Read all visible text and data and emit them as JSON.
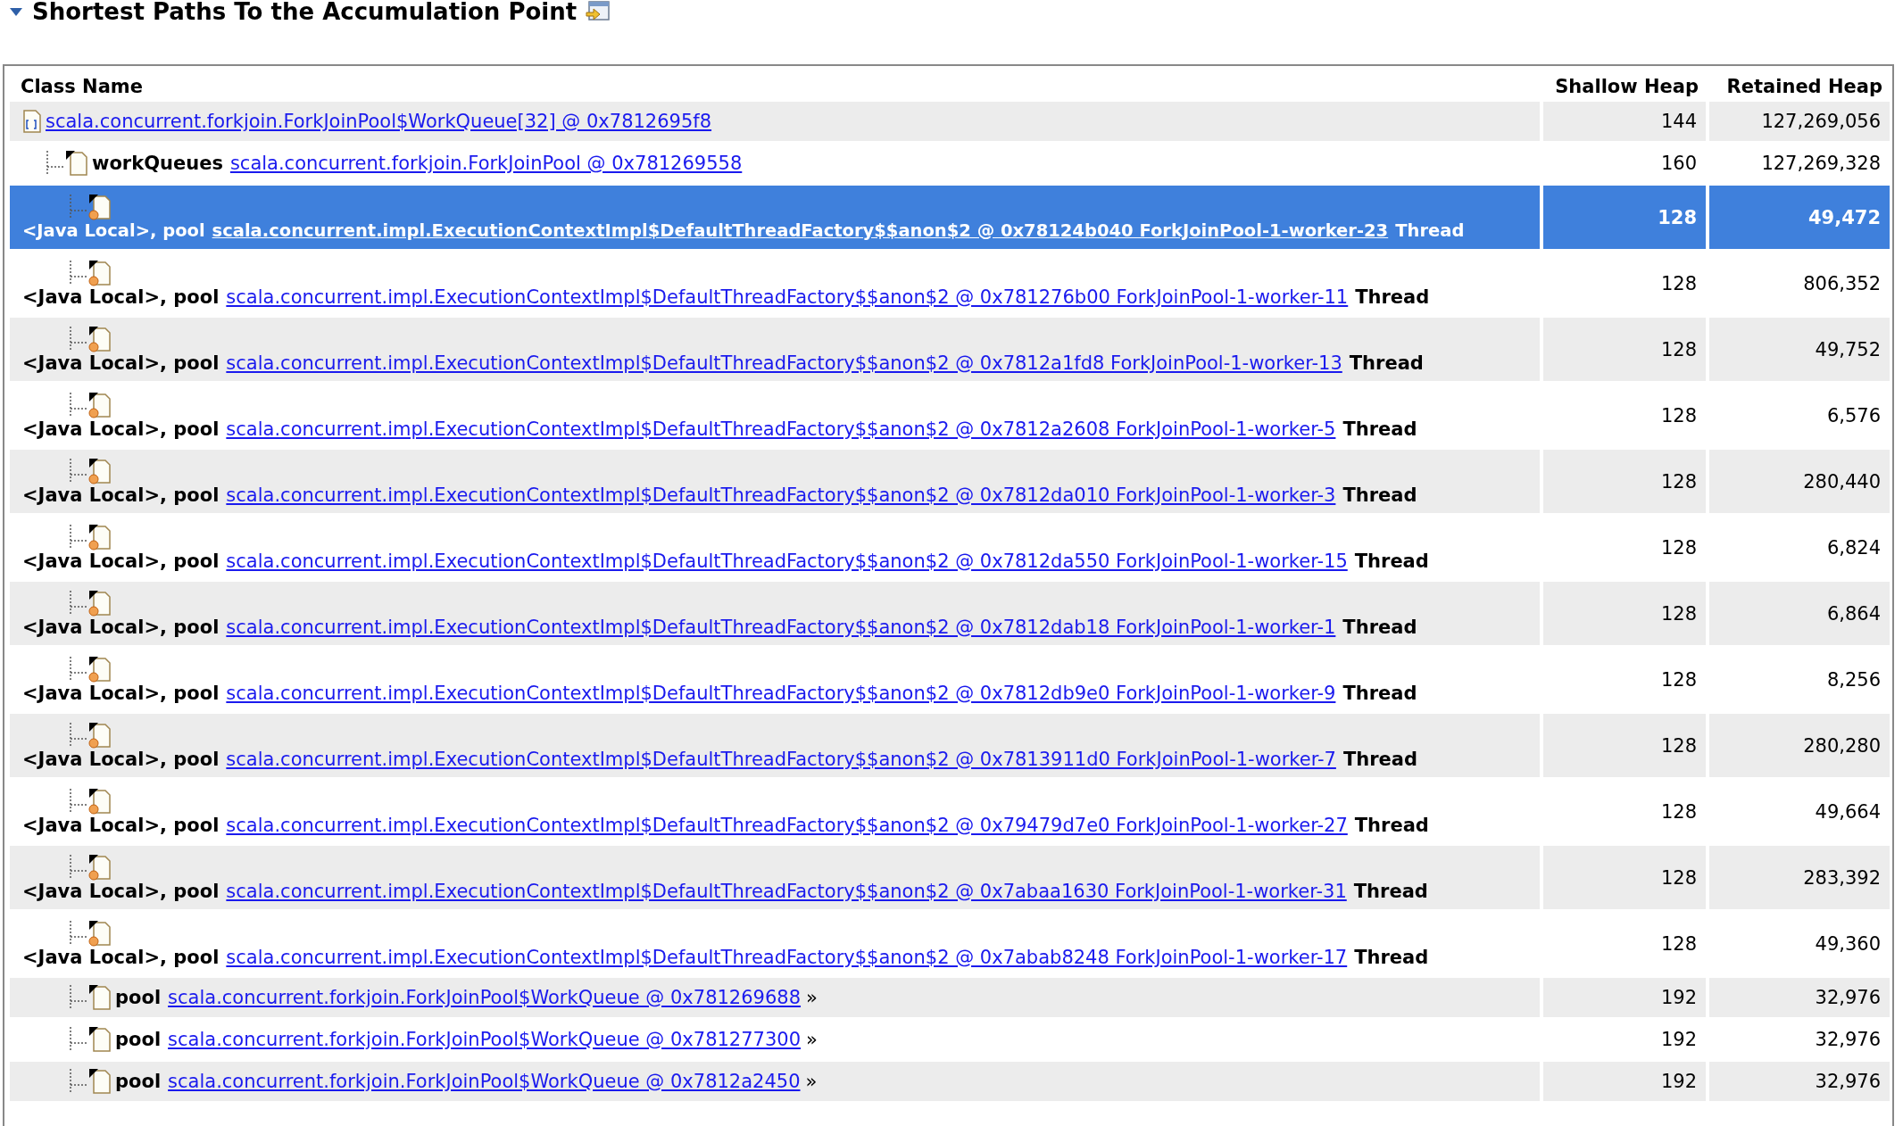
{
  "section": {
    "title": "Shortest Paths To the Accumulation Point",
    "expanded": true
  },
  "table": {
    "columns": [
      "Class Name",
      "Shallow Heap",
      "Retained Heap"
    ],
    "rows": [
      {
        "kind": "array",
        "link": "scala.concurrent.forkjoin.ForkJoinPool$WorkQueue[32] @ 0x7812695f8",
        "shallow": "144",
        "retained": "127,269,056",
        "selected": false,
        "children": [
          {
            "kind": "object",
            "prefix": "workQueues",
            "link": "scala.concurrent.forkjoin.ForkJoinPool @ 0x781269558",
            "shallow": "160",
            "retained": "127,269,328",
            "selected": false,
            "children": [
              {
                "kind": "root",
                "prefix": "<Java Local>, pool",
                "link": "scala.concurrent.impl.ExecutionContextImpl$DefaultThreadFactory$$anon$2 @ 0x78124b040 ForkJoinPool-1-worker-23",
                "suffix": "Thread",
                "shallow": "128",
                "retained": "49,472",
                "selected": true
              },
              {
                "kind": "root",
                "prefix": "<Java Local>, pool",
                "link": "scala.concurrent.impl.ExecutionContextImpl$DefaultThreadFactory$$anon$2 @ 0x781276b00 ForkJoinPool-1-worker-11",
                "suffix": "Thread",
                "shallow": "128",
                "retained": "806,352",
                "selected": false
              },
              {
                "kind": "root",
                "prefix": "<Java Local>, pool",
                "link": "scala.concurrent.impl.ExecutionContextImpl$DefaultThreadFactory$$anon$2 @ 0x7812a1fd8 ForkJoinPool-1-worker-13",
                "suffix": "Thread",
                "shallow": "128",
                "retained": "49,752",
                "selected": false
              },
              {
                "kind": "root",
                "prefix": "<Java Local>, pool",
                "link": "scala.concurrent.impl.ExecutionContextImpl$DefaultThreadFactory$$anon$2 @ 0x7812a2608 ForkJoinPool-1-worker-5",
                "suffix": "Thread",
                "shallow": "128",
                "retained": "6,576",
                "selected": false
              },
              {
                "kind": "root",
                "prefix": "<Java Local>, pool",
                "link": "scala.concurrent.impl.ExecutionContextImpl$DefaultThreadFactory$$anon$2 @ 0x7812da010 ForkJoinPool-1-worker-3",
                "suffix": "Thread",
                "shallow": "128",
                "retained": "280,440",
                "selected": false
              },
              {
                "kind": "root",
                "prefix": "<Java Local>, pool",
                "link": "scala.concurrent.impl.ExecutionContextImpl$DefaultThreadFactory$$anon$2 @ 0x7812da550 ForkJoinPool-1-worker-15",
                "suffix": "Thread",
                "shallow": "128",
                "retained": "6,824",
                "selected": false
              },
              {
                "kind": "root",
                "prefix": "<Java Local>, pool",
                "link": "scala.concurrent.impl.ExecutionContextImpl$DefaultThreadFactory$$anon$2 @ 0x7812dab18 ForkJoinPool-1-worker-1",
                "suffix": "Thread",
                "shallow": "128",
                "retained": "6,864",
                "selected": false
              },
              {
                "kind": "root",
                "prefix": "<Java Local>, pool",
                "link": "scala.concurrent.impl.ExecutionContextImpl$DefaultThreadFactory$$anon$2 @ 0x7812db9e0 ForkJoinPool-1-worker-9",
                "suffix": "Thread",
                "shallow": "128",
                "retained": "8,256",
                "selected": false
              },
              {
                "kind": "root",
                "prefix": "<Java Local>, pool",
                "link": "scala.concurrent.impl.ExecutionContextImpl$DefaultThreadFactory$$anon$2 @ 0x7813911d0 ForkJoinPool-1-worker-7",
                "suffix": "Thread",
                "shallow": "128",
                "retained": "280,280",
                "selected": false
              },
              {
                "kind": "root",
                "prefix": "<Java Local>, pool",
                "link": "scala.concurrent.impl.ExecutionContextImpl$DefaultThreadFactory$$anon$2 @ 0x79479d7e0 ForkJoinPool-1-worker-27",
                "suffix": "Thread",
                "shallow": "128",
                "retained": "49,664",
                "selected": false
              },
              {
                "kind": "root",
                "prefix": "<Java Local>, pool",
                "link": "scala.concurrent.impl.ExecutionContextImpl$DefaultThreadFactory$$anon$2 @ 0x7abaa1630 ForkJoinPool-1-worker-31",
                "suffix": "Thread",
                "shallow": "128",
                "retained": "283,392",
                "selected": false
              },
              {
                "kind": "root",
                "prefix": "<Java Local>, pool",
                "link": "scala.concurrent.impl.ExecutionContextImpl$DefaultThreadFactory$$anon$2 @ 0x7abab8248 ForkJoinPool-1-worker-17",
                "suffix": "Thread",
                "shallow": "128",
                "retained": "49,360",
                "selected": false
              },
              {
                "kind": "object",
                "prefix": "pool",
                "link": "scala.concurrent.forkjoin.ForkJoinPool$WorkQueue @ 0x781269688",
                "more": "»",
                "shallow": "192",
                "retained": "32,976",
                "selected": false
              },
              {
                "kind": "object",
                "prefix": "pool",
                "link": "scala.concurrent.forkjoin.ForkJoinPool$WorkQueue @ 0x781277300",
                "more": "»",
                "shallow": "192",
                "retained": "32,976",
                "selected": false
              },
              {
                "kind": "object",
                "prefix": "pool",
                "link": "scala.concurrent.forkjoin.ForkJoinPool$WorkQueue @ 0x7812a2450",
                "more": "»",
                "shallow": "192",
                "retained": "32,976",
                "selected": false
              }
            ]
          }
        ]
      }
    ]
  }
}
